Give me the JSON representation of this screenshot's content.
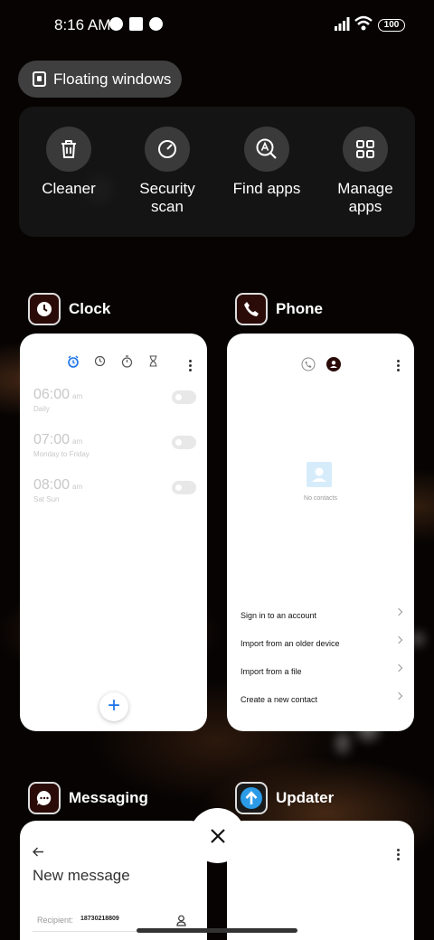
{
  "status_bar": {
    "time": "8:16 AM",
    "battery": "100",
    "icons": [
      "notification-icon",
      "notification-icon",
      "notification-icon",
      "signal-icon",
      "wifi-icon",
      "battery-icon"
    ]
  },
  "floating_windows": {
    "label": "Floating windows"
  },
  "quick_actions": [
    {
      "label": "Cleaner",
      "icon": "trash-icon"
    },
    {
      "label": "Security scan",
      "icon": "security-scan-icon"
    },
    {
      "label": "Find apps",
      "icon": "find-apps-icon"
    },
    {
      "label": "Manage apps",
      "icon": "grid-icon"
    }
  ],
  "apps": {
    "clock": {
      "name": "Clock",
      "alarms": [
        {
          "time": "06:00",
          "ampm": "am",
          "repeat": "Daily"
        },
        {
          "time": "07:00",
          "ampm": "am",
          "repeat": "Monday to Friday"
        },
        {
          "time": "08:00",
          "ampm": "am",
          "repeat": "Sat Sun"
        }
      ],
      "fab": "+"
    },
    "phone": {
      "name": "Phone",
      "empty_text": "No contacts",
      "items": [
        "Sign in to an account",
        "Import from an older device",
        "Import from a file",
        "Create a new contact"
      ]
    },
    "messaging": {
      "name": "Messaging",
      "title": "New message",
      "recipient_label": "Recipient:",
      "recipient_value": "18730218809"
    },
    "updater": {
      "name": "Updater"
    }
  },
  "colors": {
    "accent": "#1a73e8",
    "card_bg": "#ffffff",
    "panel_bg": "#161616"
  }
}
